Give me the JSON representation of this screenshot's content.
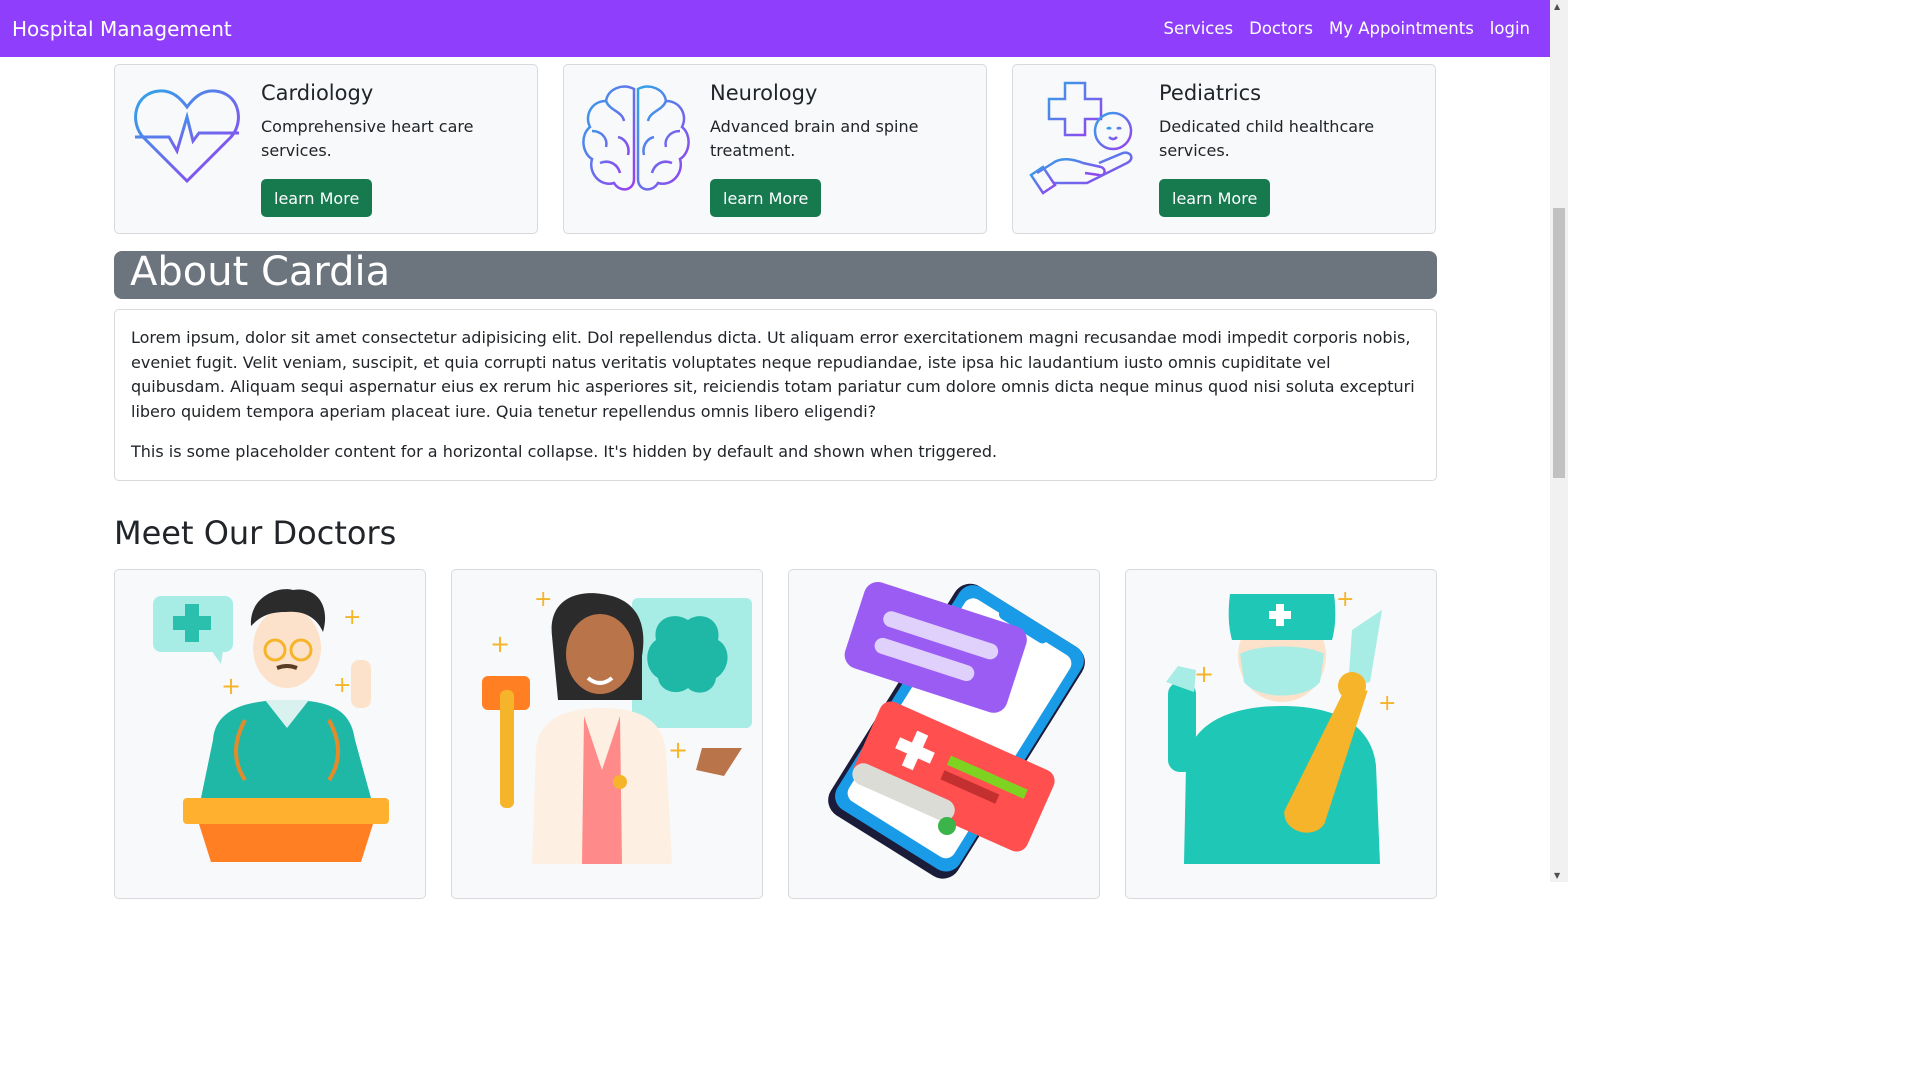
{
  "navbar": {
    "brand": "Hospital Management",
    "links": [
      "Services",
      "Doctors",
      "My Appointments",
      "login"
    ],
    "color": "#8f3ffc"
  },
  "services": [
    {
      "title": "Cardiology",
      "description": "Comprehensive heart care services.",
      "button": "learn More",
      "icon": "heart-pulse-icon"
    },
    {
      "title": "Neurology",
      "description": "Advanced brain and spine treatment.",
      "button": "learn More",
      "icon": "brain-icon"
    },
    {
      "title": "Pediatrics",
      "description": "Dedicated child healthcare services.",
      "button": "learn More",
      "icon": "child-care-icon"
    }
  ],
  "about": {
    "title": "About Cardia",
    "paragraph1": "Lorem ipsum, dolor sit amet consectetur adipisicing elit. Dol repellendus dicta. Ut aliquam error exercitationem magni recusandae modi impedit corporis nobis, eveniet fugit. Velit veniam, suscipit, et quia corrupti natus veritatis voluptates neque repudiandae, iste ipsa hic laudantium iusto omnis cupiditate vel quibusdam. Aliquam sequi aspernatur eius ex rerum hic asperiores sit, reiciendis totam pariatur cum dolore omnis dicta neque minus quod nisi soluta excepturi libero quidem tempora aperiam placeat iure. Quia tenetur repellendus omnis libero eligendi?",
    "paragraph2": "This is some placeholder content for a horizontal collapse. It's hidden by default and shown when triggered."
  },
  "doctors": {
    "heading": "Meet Our Doctors",
    "cards": [
      "doctor-lecturer-illustration",
      "doctor-neurologist-illustration",
      "medical-app-illustration",
      "surgeon-illustration"
    ]
  },
  "colors": {
    "button": "#177a4f",
    "about_header": "#6c757d"
  }
}
